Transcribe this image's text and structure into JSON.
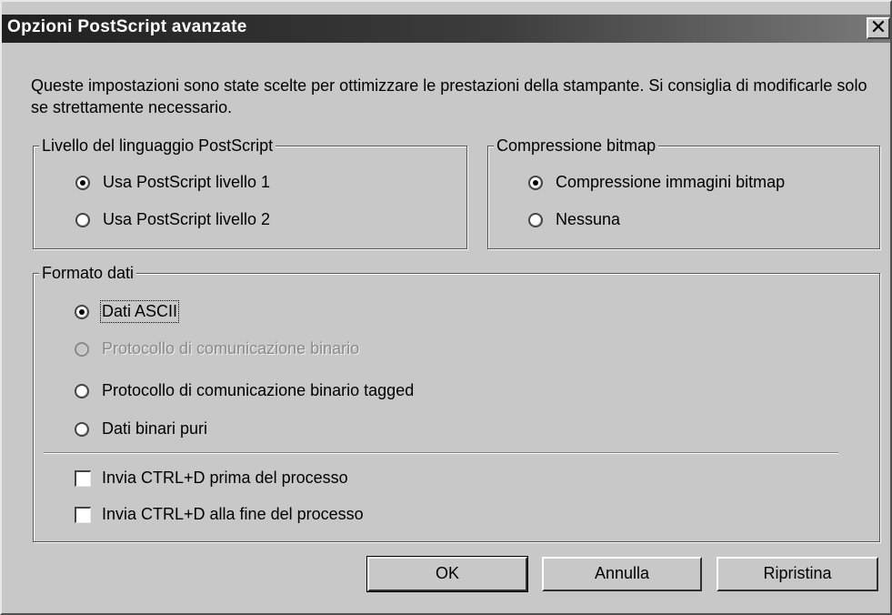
{
  "window": {
    "title": "Opzioni PostScript avanzate",
    "close_label": "✕"
  },
  "intro_text": "Queste impostazioni sono state scelte per ottimizzare le prestazioni della stampante. Si consiglia di modificarle solo se strettamente necessario.",
  "postscript_level": {
    "legend": "Livello del linguaggio PostScript",
    "options": [
      {
        "label": "Usa PostScript livello 1",
        "checked": true
      },
      {
        "label": "Usa PostScript livello 2",
        "checked": false
      }
    ]
  },
  "bitmap_compression": {
    "legend": "Compressione bitmap",
    "options": [
      {
        "label": "Compressione immagini bitmap",
        "checked": true
      },
      {
        "label": "Nessuna",
        "checked": false
      }
    ]
  },
  "data_format": {
    "legend": "Formato dati",
    "options": [
      {
        "label": "Dati ASCII",
        "checked": true,
        "enabled": true
      },
      {
        "label": "Protocollo di comunicazione binario",
        "checked": false,
        "enabled": false
      },
      {
        "label": "Protocollo di comunicazione binario tagged",
        "checked": false,
        "enabled": true
      },
      {
        "label": "Dati binari puri",
        "checked": false,
        "enabled": true
      }
    ],
    "checkboxes": [
      {
        "label": "Invia CTRL+D prima del processo",
        "checked": false
      },
      {
        "label": "Invia CTRL+D alla fine del processo",
        "checked": false
      }
    ]
  },
  "buttons": {
    "ok": "OK",
    "cancel": "Annulla",
    "reset": "Ripristina"
  }
}
